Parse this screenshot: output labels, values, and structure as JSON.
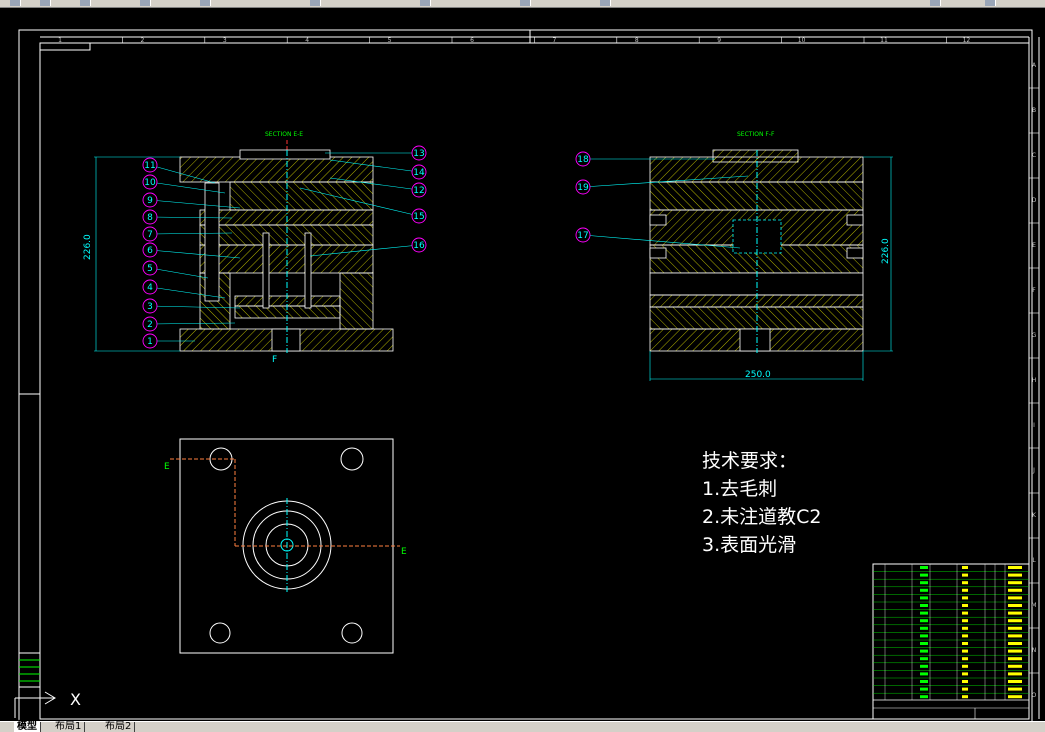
{
  "tabs": [
    {
      "label": "模型",
      "active": true
    },
    {
      "label": "布局1",
      "active": false
    },
    {
      "label": "布局2",
      "active": false
    }
  ],
  "drawing": {
    "section_ee_title": "SECTION E-E",
    "section_ff_title": "SECTION F-F",
    "dim_height_left": "226.0",
    "dim_height_right": "226.0",
    "dim_width": "250.0",
    "cut_label_e": "E",
    "cut_label_f": "F",
    "balloons_left": [
      "11",
      "10",
      "9",
      "8",
      "7",
      "6",
      "5",
      "4",
      "3",
      "2",
      "1"
    ],
    "balloons_right_of_left_view": [
      "13",
      "14",
      "12",
      "15",
      "16"
    ],
    "balloons_ff": [
      "18",
      "19",
      "17"
    ],
    "column_ticks": [
      "1",
      "2",
      "3",
      "4",
      "5",
      "6",
      "7",
      "8",
      "9",
      "10",
      "11",
      "12"
    ],
    "row_ticks": [
      "A",
      "B",
      "C",
      "D",
      "E",
      "F",
      "G",
      "H",
      "I",
      "J",
      "K",
      "L",
      "M",
      "N",
      "O"
    ],
    "tech_requirements": {
      "title": "技术要求：",
      "items": [
        "1.去毛刺",
        "2.未注道教C2",
        "3.表面光滑"
      ]
    }
  },
  "ucs_icon_label": "X",
  "colors": {
    "background": "#000000",
    "line_white": "#ffffff",
    "line_cyan": "#00ffff",
    "line_yellow": "#ffff00",
    "hatch": "#ffff00",
    "centerline": "#ff3333",
    "balloon": "#ff00ff",
    "section_text": "#00ff00"
  }
}
